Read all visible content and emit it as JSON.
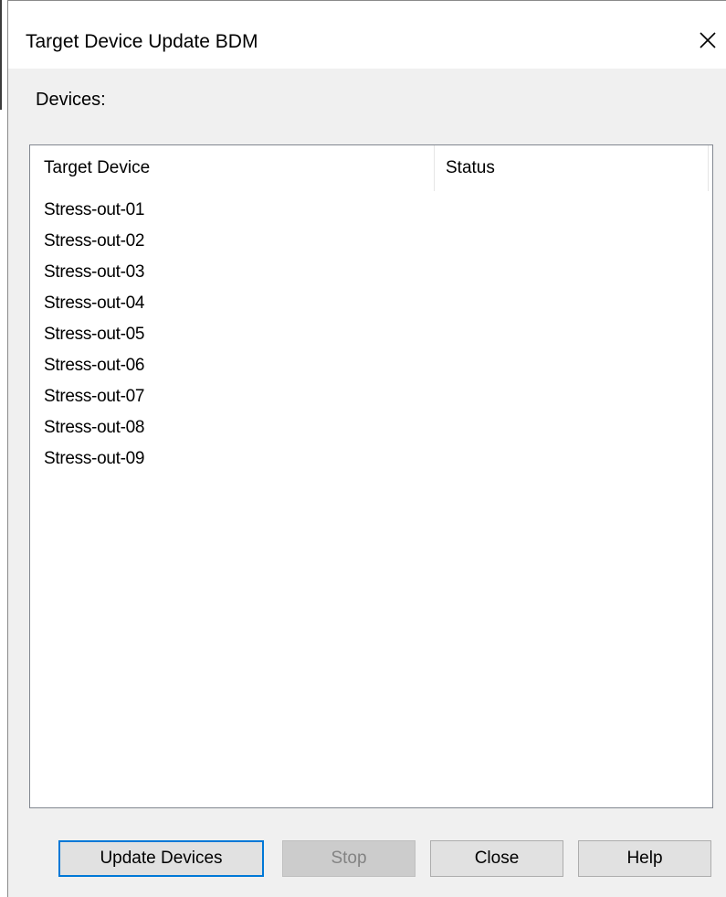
{
  "window": {
    "title": "Target Device Update BDM"
  },
  "devices_label": "Devices:",
  "list": {
    "columns": [
      "Target Device",
      "Status"
    ],
    "rows": [
      {
        "target": "Stress-out-01",
        "status": ""
      },
      {
        "target": "Stress-out-02",
        "status": ""
      },
      {
        "target": "Stress-out-03",
        "status": ""
      },
      {
        "target": "Stress-out-04",
        "status": ""
      },
      {
        "target": "Stress-out-05",
        "status": ""
      },
      {
        "target": "Stress-out-06",
        "status": ""
      },
      {
        "target": "Stress-out-07",
        "status": ""
      },
      {
        "target": "Stress-out-08",
        "status": ""
      },
      {
        "target": "Stress-out-09",
        "status": ""
      }
    ]
  },
  "buttons": {
    "update": "Update Devices",
    "stop": "Stop",
    "close": "Close",
    "help": "Help"
  },
  "icons": {
    "close": "close-icon"
  },
  "colors": {
    "focus_border": "#0078d7",
    "dialog_bg": "#f0f0f0",
    "disabled_text": "#838383"
  }
}
